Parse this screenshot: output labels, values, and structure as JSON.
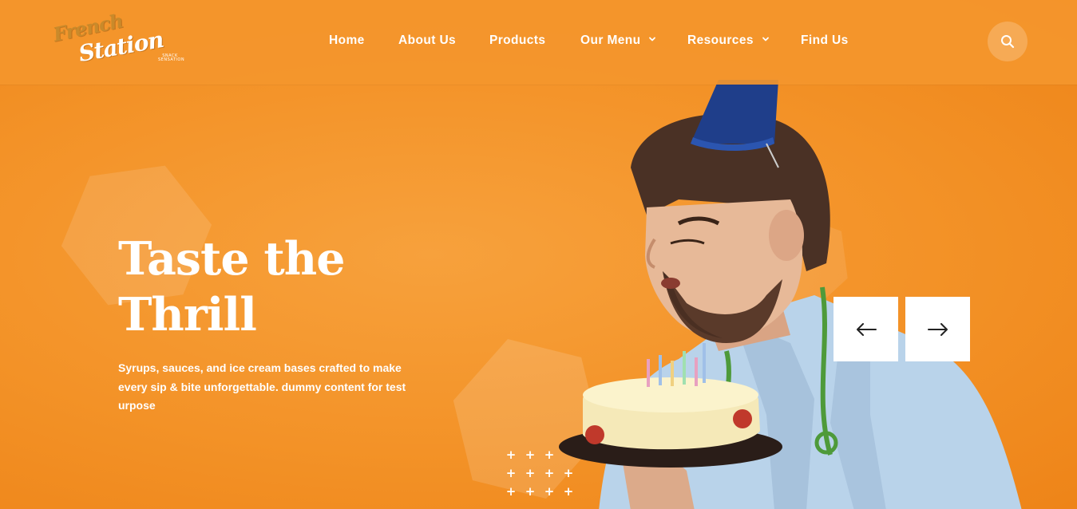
{
  "brand": {
    "line1": "French",
    "line2": "Station",
    "tagline": "SNACK SENSATION"
  },
  "nav": {
    "items": [
      {
        "label": "Home",
        "has_dropdown": false
      },
      {
        "label": "About Us",
        "has_dropdown": false
      },
      {
        "label": "Products",
        "has_dropdown": false
      },
      {
        "label": "Our Menu",
        "has_dropdown": true
      },
      {
        "label": "Resources",
        "has_dropdown": true
      },
      {
        "label": "Find Us",
        "has_dropdown": false
      }
    ],
    "search_icon": "search-icon"
  },
  "hero": {
    "headline_line1": "Taste the",
    "headline_line2": "Thrill",
    "description": "Syrups, sauces, and ice cream bases crafted to make every sip & bite unforgettable. dummy content for test urpose",
    "prev_icon": "arrow-left-icon",
    "next_icon": "arrow-right-icon"
  },
  "colors": {
    "background": "#f39227",
    "header": "#f4962d",
    "text": "#ffffff",
    "button_bg": "#ffffff",
    "arrow": "#222222"
  }
}
